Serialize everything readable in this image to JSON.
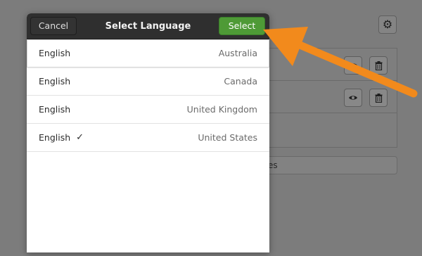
{
  "background": {
    "partial_button_label": "es"
  },
  "dialog": {
    "title": "Select Language",
    "cancel_label": "Cancel",
    "select_label": "Select",
    "languages": [
      {
        "name": "English",
        "region": "Australia",
        "checked": false
      },
      {
        "name": "English",
        "region": "Canada",
        "checked": false
      },
      {
        "name": "English",
        "region": "United Kingdom",
        "checked": false
      },
      {
        "name": "English",
        "region": "United States",
        "checked": true
      }
    ],
    "check_glyph": "✓"
  },
  "colors": {
    "select_button": "#4e9a36",
    "headerbar": "#2f2f2f",
    "annotation_arrow": "#f28a1c"
  },
  "icons": {
    "settings": "gear-icon",
    "visibility": "eye-icon",
    "delete": "trash-icon"
  }
}
